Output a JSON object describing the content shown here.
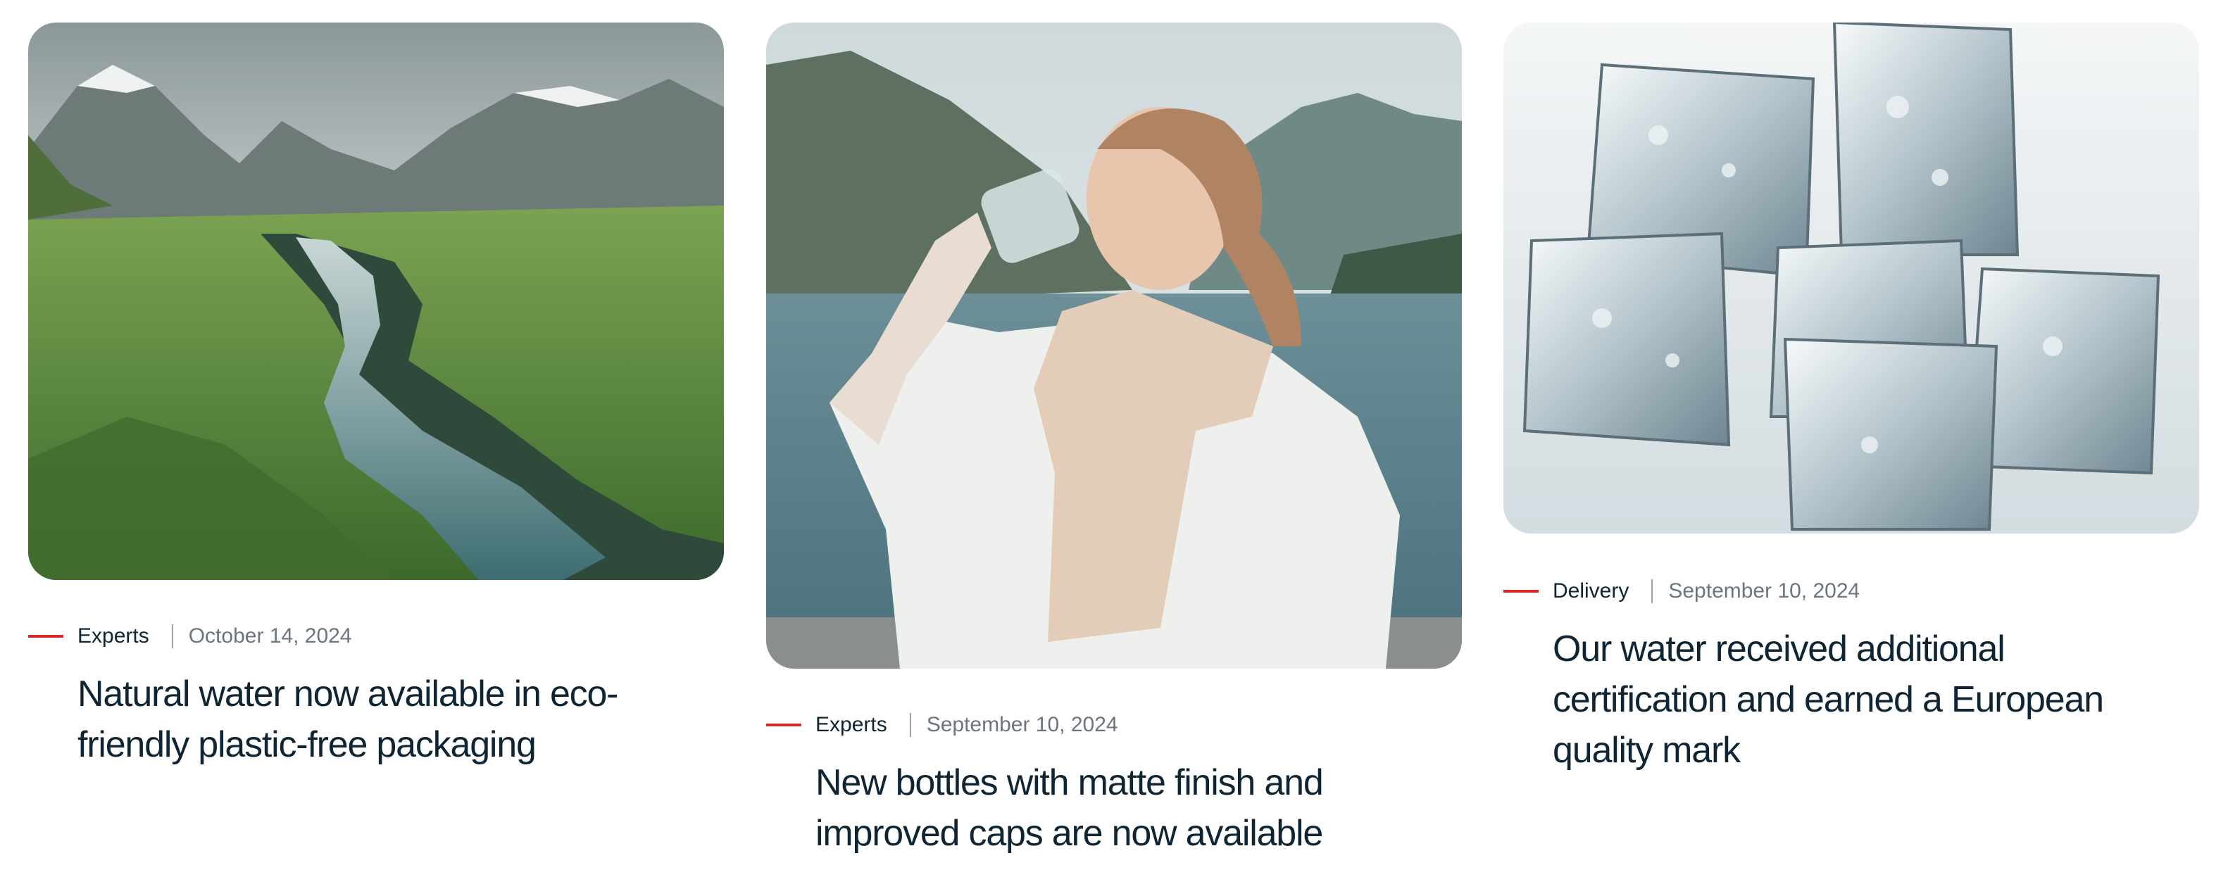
{
  "articles": [
    {
      "category": "Experts",
      "date": "October 14, 2024",
      "title": "Natural water now available in eco-friendly plastic-free packaging",
      "image": "mountain-river-valley"
    },
    {
      "category": "Experts",
      "date": "September 10, 2024",
      "title": "New bottles with matte finish and improved caps are now available",
      "image": "woman-drinking-water-by-lake"
    },
    {
      "category": "Delivery",
      "date": "September 10, 2024",
      "title": "Our water received additional certification and earned a European quality mark",
      "image": "ice-cubes"
    }
  ],
  "colors": {
    "accent": "#d42a2a",
    "text": "#0f2533",
    "muted": "#6a7580"
  }
}
